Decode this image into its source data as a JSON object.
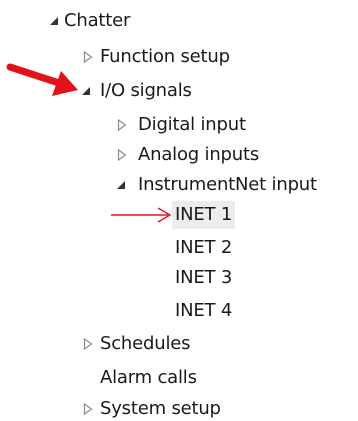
{
  "tree": {
    "nodes": [
      {
        "label": "Chatter",
        "state": "expanded"
      },
      {
        "label": "Function setup",
        "state": "collapsed"
      },
      {
        "label": "I/O signals",
        "state": "expanded"
      },
      {
        "label": "Digital input",
        "state": "collapsed"
      },
      {
        "label": "Analog inputs",
        "state": "collapsed"
      },
      {
        "label": "InstrumentNet input",
        "state": "expanded"
      },
      {
        "label": "INET 1",
        "state": "leaf",
        "selected": true
      },
      {
        "label": "INET 2",
        "state": "leaf"
      },
      {
        "label": "INET 3",
        "state": "leaf"
      },
      {
        "label": "INET 4",
        "state": "leaf"
      },
      {
        "label": "Schedules",
        "state": "collapsed"
      },
      {
        "label": "Alarm calls",
        "state": "leaf"
      },
      {
        "label": "System setup",
        "state": "collapsed"
      }
    ]
  },
  "colors": {
    "annotation_arrow": "#e3121a",
    "selected_background": "#ececec",
    "expanded_glyph": "#333333",
    "collapsed_glyph": "#8c8c8c"
  },
  "icons": {
    "expanded": "expanded-triangle-icon",
    "collapsed": "collapsed-triangle-icon"
  }
}
